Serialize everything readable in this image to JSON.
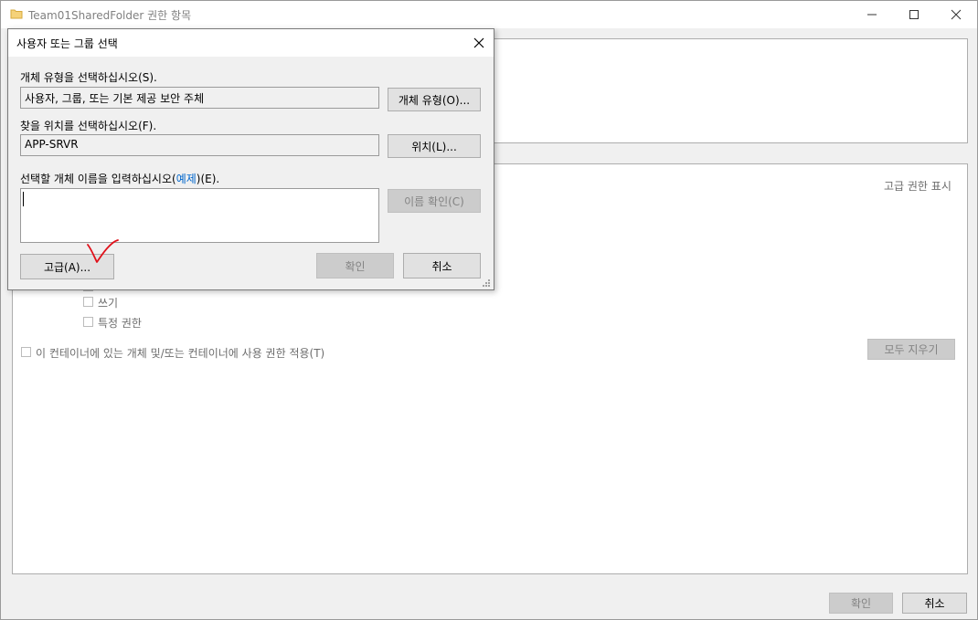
{
  "window": {
    "title": "Team01SharedFolder 권한 항목"
  },
  "main": {
    "advanced_link": "고급 권한 표시",
    "permissions": [
      {
        "label": "쓰기"
      },
      {
        "label": "특정 권한"
      }
    ],
    "apply_checkbox_label": "이 컨테이너에 있는 개체 및/또는 컨테이너에 사용 권한 적용(T)",
    "clear_all_button": "모두 지우기",
    "ok_button": "확인",
    "cancel_button": "취소"
  },
  "dialog": {
    "title": "사용자 또는 그룹 선택",
    "object_type_label": "개체 유형을 선택하십시오(S).",
    "object_type_value": "사용자, 그룹, 또는 기본 제공 보안 주체",
    "object_type_button": "개체 유형(O)...",
    "location_label": "찾을 위치를 선택하십시오(F).",
    "location_value": "APP-SRVR",
    "location_button": "위치(L)...",
    "name_label_before": "선택할 개체 이름을 입력하십시오(",
    "name_label_link": "예제",
    "name_label_after": ")(E).",
    "check_names_button": "이름 확인(C)",
    "advanced_button": "고급(A)...",
    "ok_button": "확인",
    "cancel_button": "취소"
  },
  "colors": {
    "annotation_checkmark": "#e0101a",
    "link": "#0066cc"
  }
}
